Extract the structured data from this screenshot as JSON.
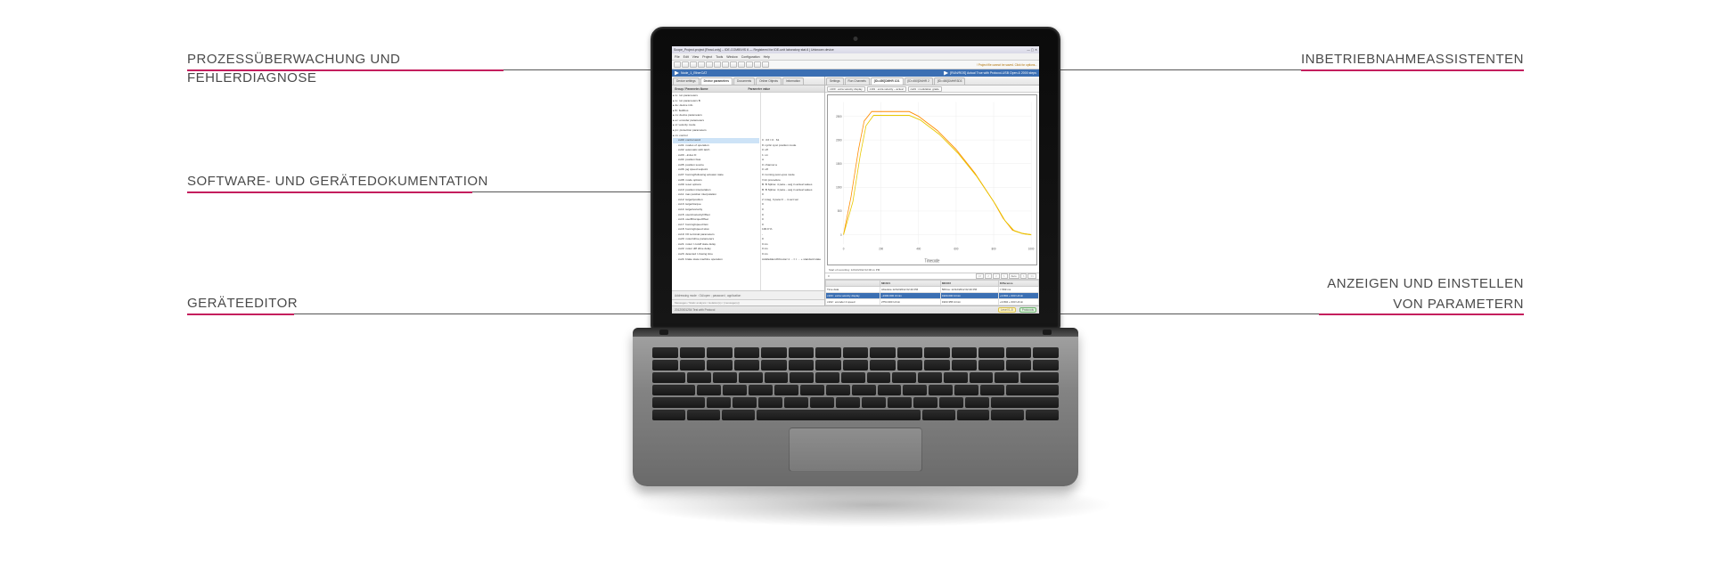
{
  "callouts": {
    "left1": "PROZESSÜBERWACHUNG UND FEHLERDIAGNOSE",
    "left2": "SOFTWARE- UND GERÄTEDOKUMENTATION",
    "left3": "GERÄTEEDITOR",
    "right1": "INBETRIEBNAHMEASSISTENTEN",
    "right2a": "ANZEIGEN UND EINSTELLEN",
    "right2b": "VON PARAMETERN"
  },
  "app": {
    "title": "Scope_Project.project [Read-only] – IDE-COMBIVIS 6 — Registered for IDE-unit laboratory stat.6 | Unknown device",
    "project_hint": "! Project file cannot be saved. Click for options...",
    "menu": [
      "File",
      "Edit",
      "View",
      "Project",
      "Tools",
      "Window",
      "Configuration",
      "Help"
    ],
    "blue_left": "Node_1_EtherCAT",
    "blue_right": "[RUN/ROS] Actual True with Protocol-USB Open & 2000 steps",
    "left_tabs": [
      "Device settings",
      "Device parameters",
      "Documents",
      "Online Objects",
      "Information"
    ],
    "left_tabs_active": 1,
    "param_group_header": "Group / Parameter-Name",
    "param_value_header": "Parameter value",
    "tree": [
      "ru: run parameters",
      "ru: run parameters B",
      "de: device info",
      "fb: fieldbus",
      "co: device parameters",
      "ec: encoder parameters",
      "st: velocity mode",
      "pn: protection parameters",
      "cs: control",
      "cs00: control word",
      "cs01: modes of operation",
      "cs02: automatic with latch",
      "cs03: –index D",
      "cs04: position bias",
      "cs05: position source",
      "cs06: jog speed setpoint",
      "cs07: homing/following actuator state",
      "cs08: mode options",
      "cs09: reset options",
      "cs10: position interpolation",
      "cs11: max position interpolation",
      "cs12: target/position",
      "cs13: target/torque",
      "cs14: target/velocity",
      "cs15: userA/velocityOffset",
      "cs16: userB/torqueOffset",
      "cs17: homing/speed fast",
      "cs18: homing/speed slow",
      "cs19: I/O terminal parameters",
      "cs20: motor/drive parameters",
      "cs21: motor I cutoff state delay",
      "cs22: motor diff drive delay",
      "cs23: detected I closing time",
      "cs24: brake state machine operation"
    ],
    "tree_selected": 9,
    "values": [
      "0 · 03 = 0 · 61",
      "8: cyclic sync position mode",
      "0: off",
      "1: on",
      "A",
      "0: channel a",
      "0: off",
      "0: running posn+pos mode",
      "V:int procedure",
      "B: B Spline: 4 para – avg in actual values",
      "B: B Spline: 4 para – avg in actual values",
      "0",
      "2: integ, 3 para O ... in act val",
      "0",
      "0",
      "0",
      "0",
      "0",
      "100.0 %",
      "-",
      "0",
      "0 ms",
      "0 ms",
      "0 ms",
      "Add/addendX/motor/-1 ... = t … + standard state"
    ],
    "bottom_tabs": "Addressing mode : OA/open ; password ; application",
    "chart_tabs": [
      "Settings",
      "Run Channels",
      "[ID=450]DMHR 1D1",
      "[ID=450]DMHR 2",
      "[ID=450]DMHR3D3"
    ],
    "chart_chips": [
      "c100 : extra velocity display",
      "c101 : extra velocity – actual",
      "ca01 : modulation grade"
    ],
    "chart_xlabel": "Timecode",
    "chart_markers_caption": "Start of recording: 12/12/2012 02:00:xx PM",
    "marker_headers": [
      "",
      "MKR#1",
      "MKR#2",
      "Difference"
    ],
    "marker_rows": [
      [
        "Time data",
        "Absolute 12/12/2012 02:40 PM",
        "569ms: 12/12/2012 02:40 PM",
        "= 569 ms"
      ],
      [
        "c100 : extra velocity display",
        "–2300.000 U/min",
        "1900.000 U/min",
        "+3.802 + 003 U/min"
      ],
      [
        "c102 : encoder 2 speed",
        "2754.300 U/min",
        "1903.355 U/min",
        "+3.802 + 003 U/min"
      ]
    ],
    "timebar_left": "0",
    "timebar_right_buttons": [
      "<<",
      "<",
      "<",
      ">",
      "Auto",
      ">",
      ">>"
    ],
    "status_left": "20120001254 Test with Protocol",
    "status_pills": [
      "Level 0–5",
      "Protocols"
    ]
  },
  "chart_data": {
    "type": "line",
    "xlabel": "Timecode",
    "ylabel": "",
    "xlim": [
      0,
      1000
    ],
    "ylim": [
      -200,
      2800
    ],
    "xticks": [
      0,
      200,
      400,
      600,
      800,
      1000
    ],
    "yticks": [
      0,
      500,
      1000,
      1500,
      2000,
      2500
    ],
    "series": [
      {
        "name": "c100 extra velocity display",
        "color": "#ff8c00",
        "x": [
          0,
          40,
          80,
          110,
          150,
          350,
          400,
          500,
          600,
          700,
          800,
          850,
          900,
          950,
          1000
        ],
        "values": [
          0,
          800,
          1800,
          2400,
          2600,
          2600,
          2500,
          2200,
          1800,
          1300,
          700,
          350,
          100,
          30,
          0
        ]
      },
      {
        "name": "c102 encoder 2 speed",
        "color": "#e8c900",
        "x": [
          0,
          50,
          90,
          120,
          160,
          350,
          410,
          510,
          610,
          710,
          810,
          860,
          910,
          960,
          1000
        ],
        "values": [
          0,
          700,
          1700,
          2300,
          2520,
          2520,
          2420,
          2120,
          1720,
          1230,
          640,
          300,
          80,
          20,
          0
        ]
      }
    ]
  }
}
